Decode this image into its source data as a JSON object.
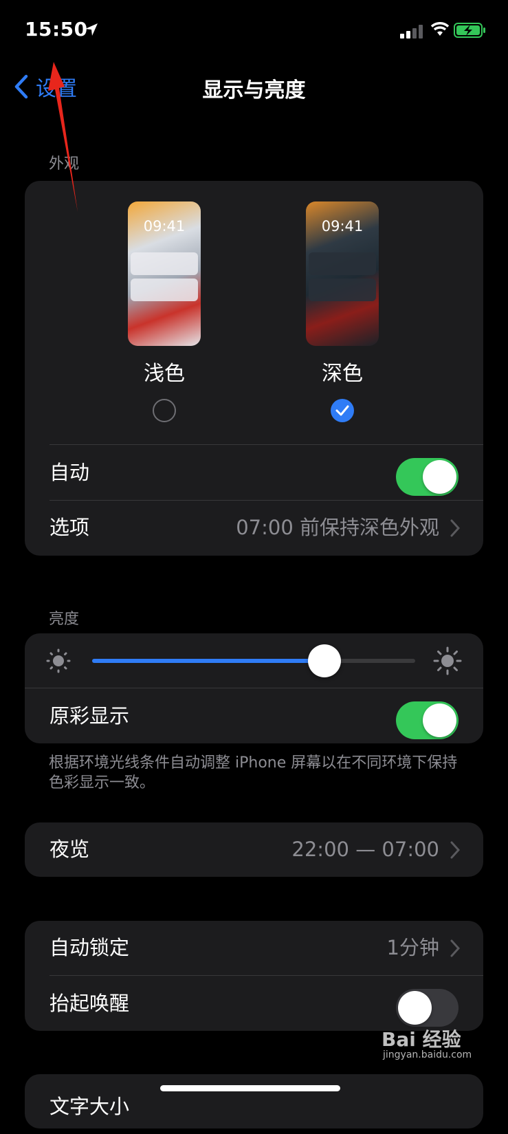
{
  "status_bar": {
    "time": "15:50"
  },
  "nav": {
    "back_label": "设置",
    "title": "显示与亮度"
  },
  "appearance": {
    "section_label": "外观",
    "light": {
      "preview_time": "09:41",
      "label": "浅色",
      "selected": false
    },
    "dark": {
      "preview_time": "09:41",
      "label": "深色",
      "selected": true
    },
    "auto": {
      "label": "自动",
      "on": true
    },
    "options": {
      "label": "选项",
      "value": "07:00 前保持深色外观"
    }
  },
  "brightness": {
    "section_label": "亮度",
    "level": 0.72,
    "true_tone": {
      "label": "原彩显示",
      "on": true
    },
    "footnote": "根据环境光线条件自动调整 iPhone 屏幕以在不同环境下保持色彩显示一致。"
  },
  "night_shift": {
    "label": "夜览",
    "value": "22:00 — 07:00"
  },
  "lock": {
    "auto_lock": {
      "label": "自动锁定",
      "value": "1分钟"
    },
    "raise_to_wake": {
      "label": "抬起唤醒",
      "on": false
    }
  },
  "next_row": {
    "label": "文字大小"
  },
  "watermark": {
    "text": "Bai 经验",
    "sub": "jingyan.baidu.com"
  },
  "colors": {
    "accent": "#2f7cf6",
    "toggle_on": "#34c759",
    "card": "#1c1c1e"
  }
}
